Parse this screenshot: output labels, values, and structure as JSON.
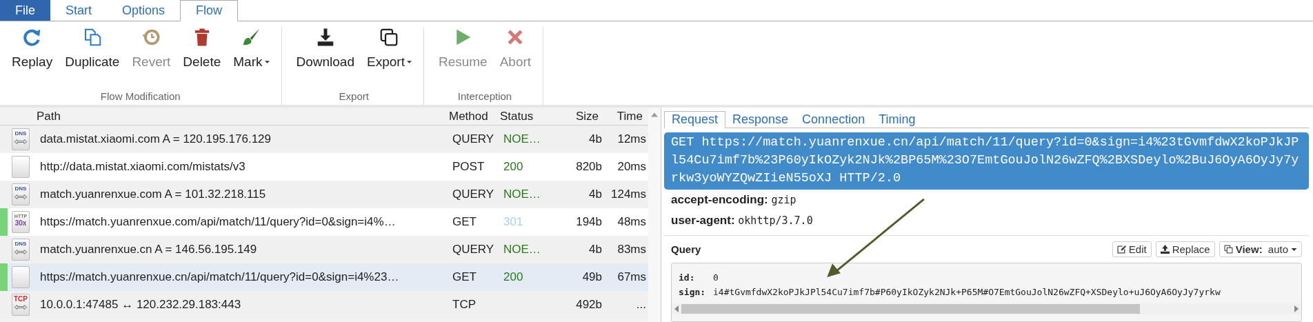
{
  "menu_tabs": [
    {
      "label": "File",
      "kind": "file",
      "selected": false
    },
    {
      "label": "Start",
      "kind": "tab",
      "selected": false
    },
    {
      "label": "Options",
      "kind": "tab",
      "selected": false
    },
    {
      "label": "Flow",
      "kind": "tab",
      "selected": true
    }
  ],
  "toolbar_groups": [
    {
      "label": "Flow Modification",
      "buttons": [
        {
          "label": "Replay",
          "kind": "replay",
          "disabled": false,
          "dropdown": false
        },
        {
          "label": "Duplicate",
          "kind": "duplicate",
          "disabled": false,
          "dropdown": false
        },
        {
          "label": "Revert",
          "kind": "revert",
          "disabled": true,
          "dropdown": false
        },
        {
          "label": "Delete",
          "kind": "delete",
          "disabled": false,
          "dropdown": false
        },
        {
          "label": "Mark",
          "kind": "mark",
          "disabled": false,
          "dropdown": true
        }
      ]
    },
    {
      "label": "Export",
      "buttons": [
        {
          "label": "Download",
          "kind": "download",
          "disabled": false,
          "dropdown": false
        },
        {
          "label": "Export",
          "kind": "export",
          "disabled": false,
          "dropdown": true
        }
      ]
    },
    {
      "label": "Interception",
      "buttons": [
        {
          "label": "Resume",
          "kind": "resume",
          "disabled": true,
          "dropdown": false
        },
        {
          "label": "Abort",
          "kind": "abort",
          "disabled": true,
          "dropdown": false
        }
      ]
    }
  ],
  "flow_table": {
    "columns": [
      "Path",
      "Method",
      "Status",
      "Size",
      "Time"
    ],
    "rows": [
      {
        "kind": "dns",
        "badge": [
          "DNS"
        ],
        "marked": false,
        "selected": false,
        "path": "data.mistat.xiaomi.com A = 120.195.176.129",
        "method": "QUERY",
        "status": "NOE…",
        "color": "#2a7a1a",
        "size": "4b",
        "time": "12ms"
      },
      {
        "kind": "plain",
        "marked": false,
        "selected": false,
        "path": "http://data.mistat.xiaomi.com/mistats/v3",
        "method": "POST",
        "status": "200",
        "color": "#2a7a1a",
        "size": "820b",
        "time": "20ms"
      },
      {
        "kind": "dns",
        "badge": [
          "DNS"
        ],
        "marked": false,
        "selected": false,
        "path": "match.yuanrenxue.com A = 101.32.218.115",
        "method": "QUERY",
        "status": "NOE…",
        "color": "#2a7a1a",
        "size": "4b",
        "time": "124ms"
      },
      {
        "kind": "http30x",
        "badge": [
          "HTTP",
          "30x"
        ],
        "marked": true,
        "selected": false,
        "path": "https://match.yuanrenxue.com/api/match/11/query?id=0&sign=i4%…",
        "method": "GET",
        "status": "301",
        "color": "#a8d4e6",
        "size": "194b",
        "time": "48ms"
      },
      {
        "kind": "dns",
        "badge": [
          "DNS"
        ],
        "marked": false,
        "selected": false,
        "path": "match.yuanrenxue.cn A = 146.56.195.149",
        "method": "QUERY",
        "status": "NOE…",
        "color": "#2a7a1a",
        "size": "4b",
        "time": "83ms"
      },
      {
        "kind": "plain",
        "marked": true,
        "selected": true,
        "path": "https://match.yuanrenxue.cn/api/match/11/query?id=0&sign=i4%23…",
        "method": "GET",
        "status": "200",
        "color": "#2a7a1a",
        "size": "49b",
        "time": "67ms"
      },
      {
        "kind": "tcp",
        "badge": [
          "TCP"
        ],
        "marked": false,
        "selected": false,
        "path": "10.0.0.1:47485 ↔ 120.232.29.183:443",
        "method": "TCP",
        "size": "492b",
        "time": "..."
      }
    ]
  },
  "detail_tabs": [
    {
      "label": "Request",
      "selected": true
    },
    {
      "label": "Response",
      "selected": false
    },
    {
      "label": "Connection",
      "selected": false
    },
    {
      "label": "Timing",
      "selected": false
    }
  ],
  "request_line": "GET https://match.yuanrenxue.cn/api/match/11/query?id=0&sign=i4%23tGvmfdwX2koPJkJPl54Cu7imf7b%23P60yIkOZyk2NJk%2BP65M%23O7EmtGouJolN26wZFQ%2BXSDeylo%2BuJ6OyA6OyJy7yrkw3yoWYZQwZIieN55oXJ HTTP/2.0",
  "headers": [
    {
      "name": "accept-encoding:",
      "value": "gzip"
    },
    {
      "name": "user-agent:",
      "value": "okhttp/3.7.0"
    }
  ],
  "query": {
    "title": "Query",
    "buttons": [
      {
        "label": "Edit",
        "kind": "edit"
      },
      {
        "label": "Replace",
        "kind": "upload"
      }
    ],
    "view": {
      "label": "View:",
      "value": "auto"
    },
    "params": [
      {
        "name": "id:",
        "value": "0"
      },
      {
        "name": "sign:",
        "value": "i4#tGvmfdwX2koPJkJPl54Cu7imf7b#P60yIkOZyk2NJk+P65M#O7EmtGouJolN26wZFQ+XSDeylo+uJ6OyA6OyJy7yrkw"
      }
    ]
  }
}
